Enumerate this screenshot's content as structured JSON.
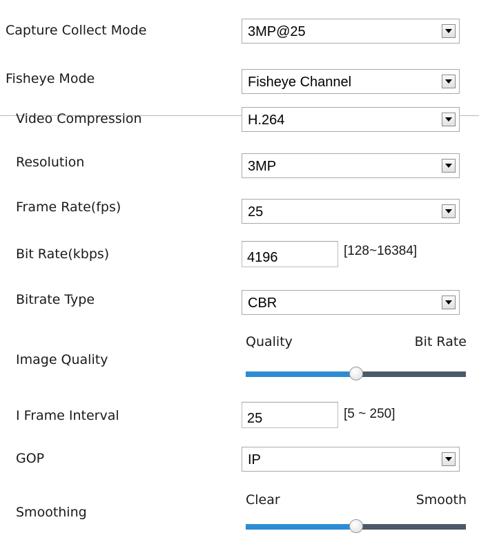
{
  "capture": {
    "label": "Capture Collect Mode",
    "value": "3MP@25"
  },
  "fisheye": {
    "label": "Fisheye Mode",
    "value": "Fisheye Channel"
  },
  "video_compression": {
    "label": "Video Compression",
    "value": "H.264"
  },
  "resolution": {
    "label": "Resolution",
    "value": "3MP"
  },
  "frame_rate": {
    "label": "Frame Rate(fps)",
    "value": "25"
  },
  "bit_rate": {
    "label": "Bit Rate(kbps)",
    "value": "4196",
    "range": "[128~16384]"
  },
  "bitrate_type": {
    "label": "Bitrate Type",
    "value": "CBR"
  },
  "image_quality": {
    "label": "Image Quality",
    "left_caption": "Quality",
    "right_caption": "Bit Rate",
    "level_percent": 50
  },
  "i_frame_interval": {
    "label": "I Frame Interval",
    "value": "25",
    "range": "[5 ~ 250]"
  },
  "gop": {
    "label": "GOP",
    "value": "IP"
  },
  "smoothing": {
    "label": "Smoothing",
    "left_caption": "Clear",
    "right_caption": "Smooth",
    "level_percent": 50
  },
  "colors": {
    "slider_fill": "#2d8cd3",
    "slider_track": "#4b5968"
  }
}
